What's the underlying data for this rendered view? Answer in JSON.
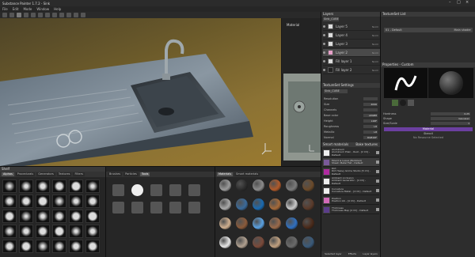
{
  "window": {
    "title": "Substance Painter 1.7.2 - Sink"
  },
  "menu": [
    "File",
    "Edit",
    "Mode",
    "Window",
    "Help"
  ],
  "viewport": {
    "label3d": "",
    "label2d": "Material"
  },
  "layers": {
    "header": "Layers",
    "texture_set": "Sink_CUBE",
    "items": [
      {
        "name": "Layer 5",
        "blend": "Norm"
      },
      {
        "name": "Layer 4",
        "blend": "Norm"
      },
      {
        "name": "Layer 3",
        "blend": "Norm"
      },
      {
        "name": "Layer 2",
        "blend": "Norm"
      },
      {
        "name": "Fill layer 1",
        "blend": "Norm"
      },
      {
        "name": "Fill layer 2",
        "blend": "Norm"
      }
    ]
  },
  "texset_settings": {
    "header": "TextureSet Settings",
    "name": "Sink_CUBE",
    "fields": [
      {
        "label": "Resolution",
        "value": ""
      },
      {
        "label": "Size",
        "value": "4096"
      },
      {
        "label": "Channels",
        "value": ""
      },
      {
        "label": "Base color",
        "value": "sRGB8"
      },
      {
        "label": "Height",
        "value": "L16F"
      },
      {
        "label": "Roughness",
        "value": "L8"
      },
      {
        "label": "Metallic",
        "value": "L8"
      },
      {
        "label": "Normal",
        "value": "RGB16F"
      }
    ]
  },
  "texture_list": {
    "header": "TextureSet List",
    "row_name": "01 - Default",
    "row_shader": "Main shader"
  },
  "properties": {
    "header": "Properties - Custom",
    "fields": [
      {
        "label": "Hardness",
        "value": "0.25"
      },
      {
        "label": "Shape",
        "value": "Gaussian"
      },
      {
        "label": "Size/Scale",
        "value": "1"
      }
    ],
    "material_label": "Material",
    "material_value": "Stencil",
    "no_selection": "No Resource Selected"
  },
  "shelf": {
    "header": "Shelf",
    "tabs": [
      "Alphas",
      "Procedurals",
      "Generators",
      "Textures",
      "Filters"
    ],
    "tabs2": [
      "Brushes",
      "Particles",
      "Tools"
    ],
    "tabs3": [
      "Materials",
      "Smart materials"
    ]
  },
  "effects": {
    "header": "Smart materials",
    "button": "Bake textures",
    "items": [
      {
        "title": "Aluminium",
        "sub": "Aluminium Plain - Rust - [2 Ch] - Default"
      },
      {
        "title": "Mould & Leave (Bubbled)",
        "sub": "Sheet: Metal Flat - Default"
      },
      {
        "title": "Dirt",
        "sub": "Dirt Heavy Grime Studio [5 Ch] - Default"
      },
      {
        "title": "Ambient occlusion",
        "sub": "Ambient Generator - [4 Ch] - Default"
      },
      {
        "title": "Curvature",
        "sub": "Curvature Metal - [4 Ch] - Default"
      },
      {
        "title": "Position",
        "sub": "Position GS - [4 Ch] - Default"
      },
      {
        "title": "Thickness",
        "sub": "Thickness Map [4 Ch] - Default"
      }
    ],
    "footer": [
      "Selected layer",
      "Effects",
      "Layer layers"
    ]
  }
}
